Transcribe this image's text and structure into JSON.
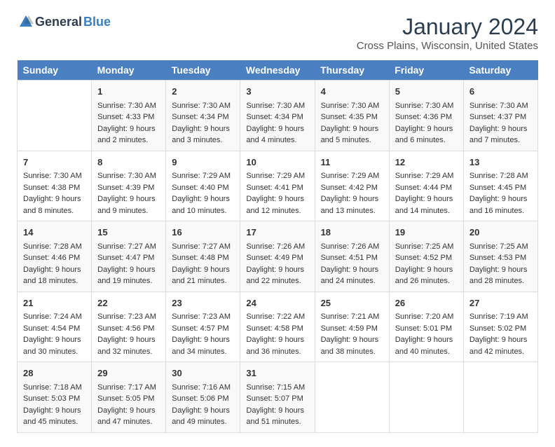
{
  "header": {
    "logo_general": "General",
    "logo_blue": "Blue",
    "month_title": "January 2024",
    "location": "Cross Plains, Wisconsin, United States"
  },
  "days_of_week": [
    "Sunday",
    "Monday",
    "Tuesday",
    "Wednesday",
    "Thursday",
    "Friday",
    "Saturday"
  ],
  "weeks": [
    [
      {
        "day": "",
        "sunrise": "",
        "sunset": "",
        "daylight": ""
      },
      {
        "day": "1",
        "sunrise": "Sunrise: 7:30 AM",
        "sunset": "Sunset: 4:33 PM",
        "daylight": "Daylight: 9 hours and 2 minutes."
      },
      {
        "day": "2",
        "sunrise": "Sunrise: 7:30 AM",
        "sunset": "Sunset: 4:34 PM",
        "daylight": "Daylight: 9 hours and 3 minutes."
      },
      {
        "day": "3",
        "sunrise": "Sunrise: 7:30 AM",
        "sunset": "Sunset: 4:34 PM",
        "daylight": "Daylight: 9 hours and 4 minutes."
      },
      {
        "day": "4",
        "sunrise": "Sunrise: 7:30 AM",
        "sunset": "Sunset: 4:35 PM",
        "daylight": "Daylight: 9 hours and 5 minutes."
      },
      {
        "day": "5",
        "sunrise": "Sunrise: 7:30 AM",
        "sunset": "Sunset: 4:36 PM",
        "daylight": "Daylight: 9 hours and 6 minutes."
      },
      {
        "day": "6",
        "sunrise": "Sunrise: 7:30 AM",
        "sunset": "Sunset: 4:37 PM",
        "daylight": "Daylight: 9 hours and 7 minutes."
      }
    ],
    [
      {
        "day": "7",
        "sunrise": "Sunrise: 7:30 AM",
        "sunset": "Sunset: 4:38 PM",
        "daylight": "Daylight: 9 hours and 8 minutes."
      },
      {
        "day": "8",
        "sunrise": "Sunrise: 7:30 AM",
        "sunset": "Sunset: 4:39 PM",
        "daylight": "Daylight: 9 hours and 9 minutes."
      },
      {
        "day": "9",
        "sunrise": "Sunrise: 7:29 AM",
        "sunset": "Sunset: 4:40 PM",
        "daylight": "Daylight: 9 hours and 10 minutes."
      },
      {
        "day": "10",
        "sunrise": "Sunrise: 7:29 AM",
        "sunset": "Sunset: 4:41 PM",
        "daylight": "Daylight: 9 hours and 12 minutes."
      },
      {
        "day": "11",
        "sunrise": "Sunrise: 7:29 AM",
        "sunset": "Sunset: 4:42 PM",
        "daylight": "Daylight: 9 hours and 13 minutes."
      },
      {
        "day": "12",
        "sunrise": "Sunrise: 7:29 AM",
        "sunset": "Sunset: 4:44 PM",
        "daylight": "Daylight: 9 hours and 14 minutes."
      },
      {
        "day": "13",
        "sunrise": "Sunrise: 7:28 AM",
        "sunset": "Sunset: 4:45 PM",
        "daylight": "Daylight: 9 hours and 16 minutes."
      }
    ],
    [
      {
        "day": "14",
        "sunrise": "Sunrise: 7:28 AM",
        "sunset": "Sunset: 4:46 PM",
        "daylight": "Daylight: 9 hours and 18 minutes."
      },
      {
        "day": "15",
        "sunrise": "Sunrise: 7:27 AM",
        "sunset": "Sunset: 4:47 PM",
        "daylight": "Daylight: 9 hours and 19 minutes."
      },
      {
        "day": "16",
        "sunrise": "Sunrise: 7:27 AM",
        "sunset": "Sunset: 4:48 PM",
        "daylight": "Daylight: 9 hours and 21 minutes."
      },
      {
        "day": "17",
        "sunrise": "Sunrise: 7:26 AM",
        "sunset": "Sunset: 4:49 PM",
        "daylight": "Daylight: 9 hours and 22 minutes."
      },
      {
        "day": "18",
        "sunrise": "Sunrise: 7:26 AM",
        "sunset": "Sunset: 4:51 PM",
        "daylight": "Daylight: 9 hours and 24 minutes."
      },
      {
        "day": "19",
        "sunrise": "Sunrise: 7:25 AM",
        "sunset": "Sunset: 4:52 PM",
        "daylight": "Daylight: 9 hours and 26 minutes."
      },
      {
        "day": "20",
        "sunrise": "Sunrise: 7:25 AM",
        "sunset": "Sunset: 4:53 PM",
        "daylight": "Daylight: 9 hours and 28 minutes."
      }
    ],
    [
      {
        "day": "21",
        "sunrise": "Sunrise: 7:24 AM",
        "sunset": "Sunset: 4:54 PM",
        "daylight": "Daylight: 9 hours and 30 minutes."
      },
      {
        "day": "22",
        "sunrise": "Sunrise: 7:23 AM",
        "sunset": "Sunset: 4:56 PM",
        "daylight": "Daylight: 9 hours and 32 minutes."
      },
      {
        "day": "23",
        "sunrise": "Sunrise: 7:23 AM",
        "sunset": "Sunset: 4:57 PM",
        "daylight": "Daylight: 9 hours and 34 minutes."
      },
      {
        "day": "24",
        "sunrise": "Sunrise: 7:22 AM",
        "sunset": "Sunset: 4:58 PM",
        "daylight": "Daylight: 9 hours and 36 minutes."
      },
      {
        "day": "25",
        "sunrise": "Sunrise: 7:21 AM",
        "sunset": "Sunset: 4:59 PM",
        "daylight": "Daylight: 9 hours and 38 minutes."
      },
      {
        "day": "26",
        "sunrise": "Sunrise: 7:20 AM",
        "sunset": "Sunset: 5:01 PM",
        "daylight": "Daylight: 9 hours and 40 minutes."
      },
      {
        "day": "27",
        "sunrise": "Sunrise: 7:19 AM",
        "sunset": "Sunset: 5:02 PM",
        "daylight": "Daylight: 9 hours and 42 minutes."
      }
    ],
    [
      {
        "day": "28",
        "sunrise": "Sunrise: 7:18 AM",
        "sunset": "Sunset: 5:03 PM",
        "daylight": "Daylight: 9 hours and 45 minutes."
      },
      {
        "day": "29",
        "sunrise": "Sunrise: 7:17 AM",
        "sunset": "Sunset: 5:05 PM",
        "daylight": "Daylight: 9 hours and 47 minutes."
      },
      {
        "day": "30",
        "sunrise": "Sunrise: 7:16 AM",
        "sunset": "Sunset: 5:06 PM",
        "daylight": "Daylight: 9 hours and 49 minutes."
      },
      {
        "day": "31",
        "sunrise": "Sunrise: 7:15 AM",
        "sunset": "Sunset: 5:07 PM",
        "daylight": "Daylight: 9 hours and 51 minutes."
      },
      {
        "day": "",
        "sunrise": "",
        "sunset": "",
        "daylight": ""
      },
      {
        "day": "",
        "sunrise": "",
        "sunset": "",
        "daylight": ""
      },
      {
        "day": "",
        "sunrise": "",
        "sunset": "",
        "daylight": ""
      }
    ]
  ]
}
